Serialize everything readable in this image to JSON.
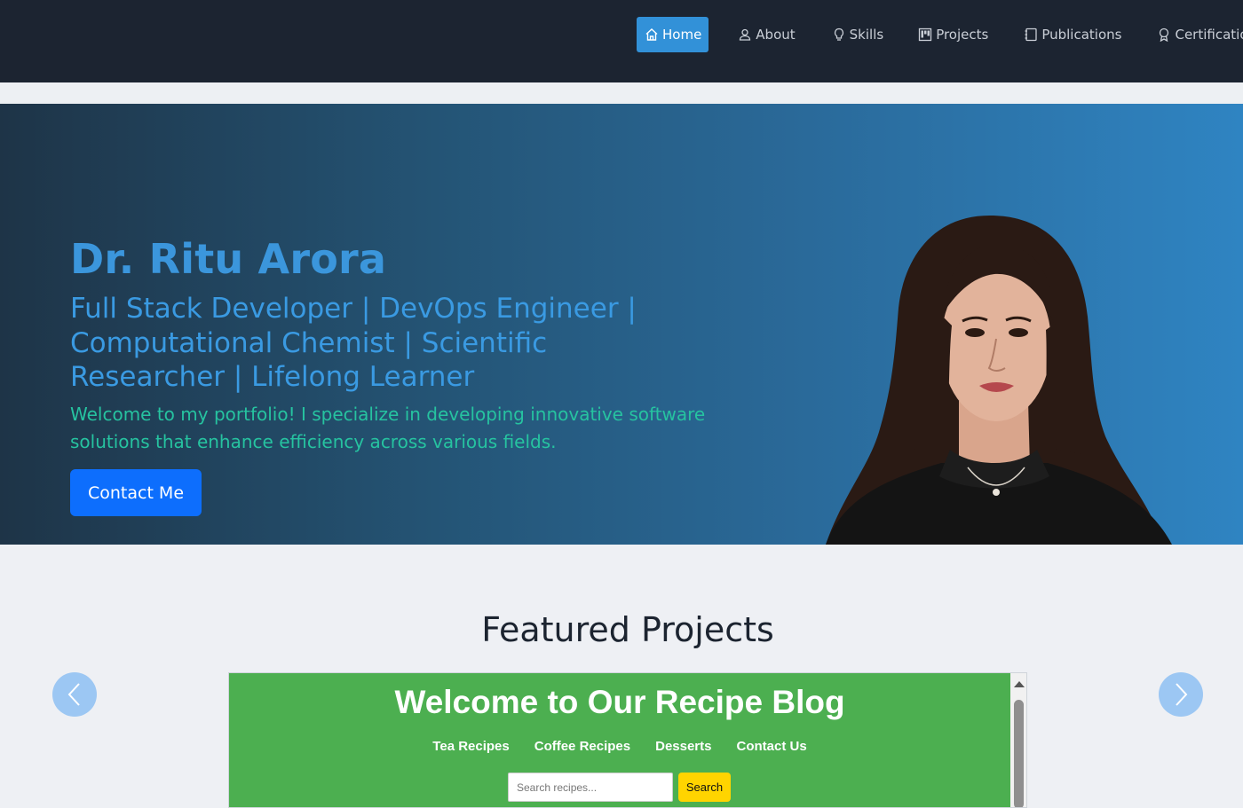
{
  "nav": {
    "items": [
      {
        "label": "Home",
        "icon": "home-icon",
        "active": true
      },
      {
        "label": "About",
        "icon": "user-icon"
      },
      {
        "label": "Skills",
        "icon": "lightbulb-icon"
      },
      {
        "label": "Projects",
        "icon": "kanban-icon"
      },
      {
        "label": "Publications",
        "icon": "journal-icon"
      },
      {
        "label": "Certifications",
        "icon": "award-icon"
      }
    ],
    "active_color": "#3291d8",
    "background": "#1c2431"
  },
  "hero": {
    "name": "Dr. Ritu Arora",
    "tagline": "Full Stack Developer | DevOps Engineer | Computational Chemist | Scientific Researcher | Lifelong Learner",
    "description": "Welcome to my portfolio! I specialize in developing innovative software solutions that enhance efficiency across various fields.",
    "cta_label": "Contact Me",
    "portrait_icon": "portrait-photo"
  },
  "featured": {
    "title": "Featured Projects",
    "prev_icon": "chevron-left-icon",
    "next_icon": "chevron-right-icon",
    "project": {
      "title": "Welcome to Our Recipe Blog",
      "nav": [
        "Tea Recipes",
        "Coffee Recipes",
        "Desserts",
        "Contact Us"
      ],
      "search_placeholder": "Search recipes...",
      "search_button": "Search",
      "background": "#4caf50"
    }
  }
}
